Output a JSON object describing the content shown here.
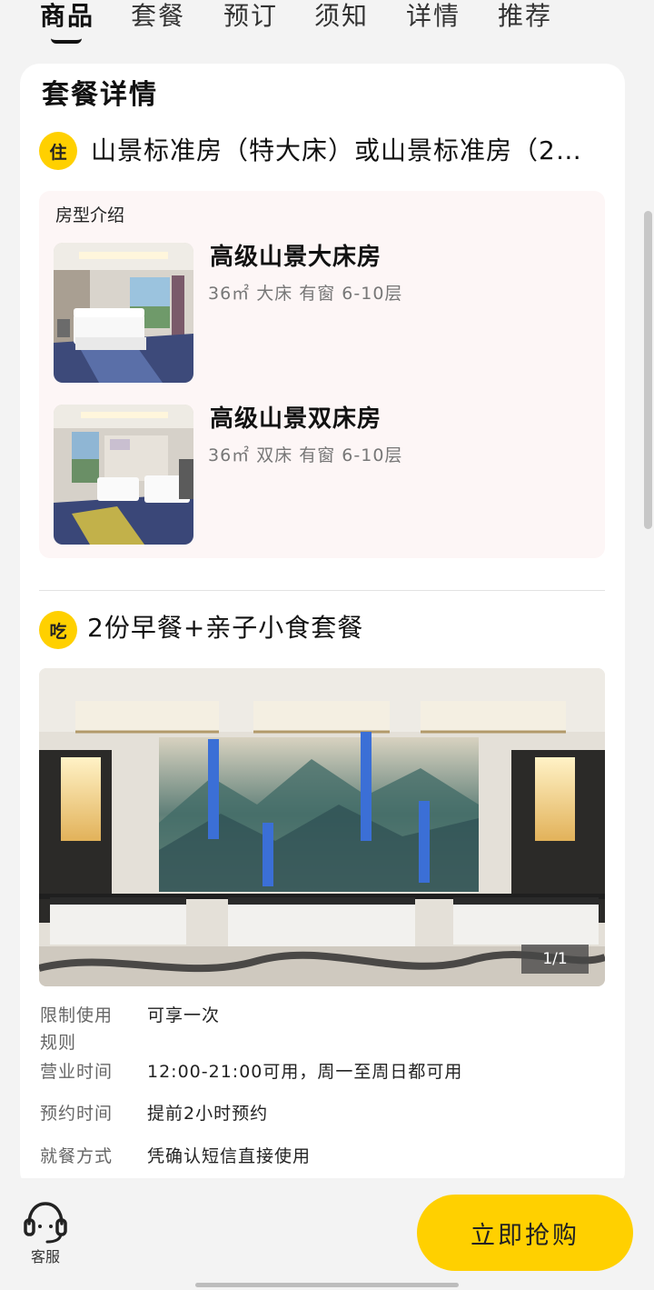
{
  "tabs": [
    "商品",
    "套餐",
    "预订",
    "须知",
    "详情",
    "推荐"
  ],
  "active_tab": "商品",
  "card": {
    "title": "套餐详情",
    "stay": {
      "badge": "住",
      "heading": "山景标准房（特大床）或山景标准房（2…",
      "intro_label": "房型介绍",
      "rooms": [
        {
          "name": "高级山景大床房",
          "spec": "36㎡  大床  有窗  6-10层"
        },
        {
          "name": "高级山景双床房",
          "spec": "36㎡  双床  有窗  6-10层"
        }
      ]
    },
    "dine": {
      "badge": "吃",
      "heading": "2份早餐+亲子小食套餐",
      "photo_counter": "1/1",
      "info": [
        {
          "label": "限制使用规则",
          "value": "可享一次"
        },
        {
          "label": "营业时间",
          "value": "12:00-21:00可用，周一至周日都可用"
        },
        {
          "label": "预约时间",
          "value": "提前2小时预约"
        },
        {
          "label": "就餐方式",
          "value": "凭确认短信直接使用"
        }
      ]
    }
  },
  "bottom": {
    "service_label": "客服",
    "buy_label": "立即抢购"
  },
  "colors": {
    "accent": "#ffd000",
    "background": "#f3f3f3",
    "room_box": "#fdf6f6"
  }
}
